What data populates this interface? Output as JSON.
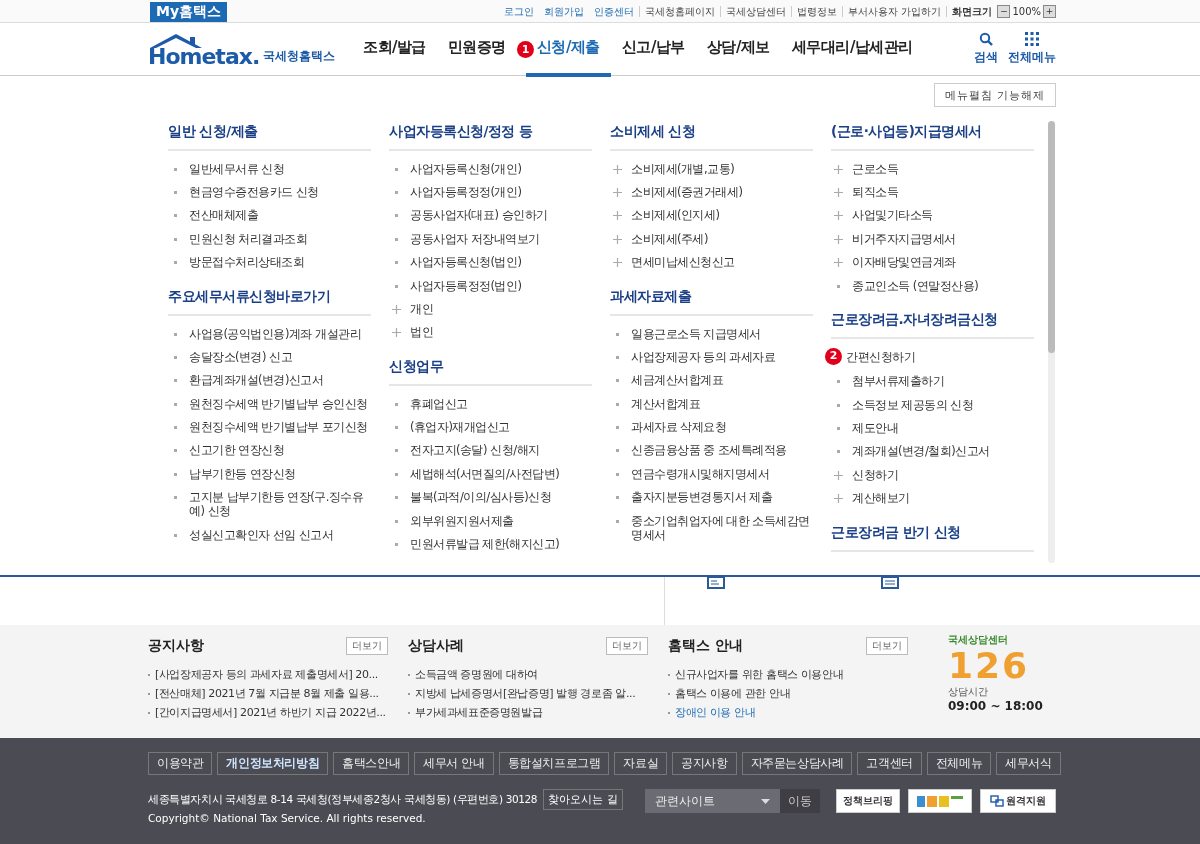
{
  "topbar": {
    "brand": "My홈택스",
    "links": [
      {
        "label": "로그인",
        "kind": "primary"
      },
      {
        "label": "회원가입",
        "kind": "primary"
      },
      {
        "label": "인증센터",
        "kind": "primary"
      },
      {
        "label": "국세청홈페이지",
        "kind": "plain"
      },
      {
        "label": "국세상담센터",
        "kind": "plain"
      },
      {
        "label": "법령정보",
        "kind": "plain"
      },
      {
        "label": "부서사용자 가입하기",
        "kind": "plain"
      }
    ],
    "zoom_label": "화면크기",
    "zoom_value": "100%",
    "zoom_out": "−",
    "zoom_in": "+"
  },
  "header": {
    "logo_word": "Hometax.",
    "logo_name": "국세청홈택스",
    "nav": [
      {
        "label": "조회/발급",
        "selected": false
      },
      {
        "label": "민원증명",
        "selected": false
      },
      {
        "label": "신청/제출",
        "selected": true,
        "badge": "1"
      },
      {
        "label": "신고/납부",
        "selected": false
      },
      {
        "label": "상담/제보",
        "selected": false
      },
      {
        "label": "세무대리/납세관리",
        "selected": false
      }
    ],
    "search": "검색",
    "all_menu": "전체메뉴"
  },
  "menu": {
    "toggle_button": "메뉴펼침 기능해제",
    "columns": [
      {
        "sections": [
          {
            "title": "일반 신청/제출",
            "items": [
              {
                "label": "일반세무서류 신청",
                "kind": "bullet"
              },
              {
                "label": "현금영수증전용카드 신청",
                "kind": "bullet"
              },
              {
                "label": "전산매체제출",
                "kind": "bullet"
              },
              {
                "label": "민원신청 처리결과조회",
                "kind": "bullet"
              },
              {
                "label": "방문접수처리상태조회",
                "kind": "bullet"
              }
            ]
          },
          {
            "title": "주요세무서류신청바로가기",
            "items": [
              {
                "label": "사업용(공익법인용)계좌 개설관리",
                "kind": "bullet"
              },
              {
                "label": "송달장소(변경) 신고",
                "kind": "bullet"
              },
              {
                "label": "환급계좌개설(변경)신고서",
                "kind": "bullet"
              },
              {
                "label": "원천징수세액 반기별납부 승인신청",
                "kind": "bullet"
              },
              {
                "label": "원천징수세액 반기별납부 포기신청",
                "kind": "bullet"
              },
              {
                "label": "신고기한 연장신청",
                "kind": "bullet"
              },
              {
                "label": "납부기한등 연장신청",
                "kind": "bullet"
              },
              {
                "label": "고지분 납부기한등 연장(구.징수유예) 신청",
                "kind": "bullet"
              },
              {
                "label": "성실신고확인자 선임 신고서",
                "kind": "bullet"
              }
            ]
          }
        ]
      },
      {
        "sections": [
          {
            "title": "사업자등록신청/정정 등",
            "items": [
              {
                "label": "사업자등록신청(개인)",
                "kind": "bullet"
              },
              {
                "label": "사업자등록정정(개인)",
                "kind": "bullet"
              },
              {
                "label": "공동사업자(대표) 승인하기",
                "kind": "bullet"
              },
              {
                "label": "공동사업자 저장내역보기",
                "kind": "bullet"
              },
              {
                "label": "사업자등록신청(법인)",
                "kind": "bullet"
              },
              {
                "label": "사업자등록정정(법인)",
                "kind": "bullet"
              },
              {
                "label": "개인",
                "kind": "plus"
              },
              {
                "label": "법인",
                "kind": "plus"
              }
            ]
          },
          {
            "title": "신청업무",
            "items": [
              {
                "label": "휴폐업신고",
                "kind": "bullet"
              },
              {
                "label": "(휴업자)재개업신고",
                "kind": "bullet"
              },
              {
                "label": "전자고지(송달) 신청/해지",
                "kind": "bullet"
              },
              {
                "label": "세법해석(서면질의/사전답변)",
                "kind": "bullet"
              },
              {
                "label": "불복(과적/이의/심사등)신청",
                "kind": "bullet"
              },
              {
                "label": "외부위원지원서제출",
                "kind": "bullet"
              },
              {
                "label": "민원서류발급 제한(해지신고)",
                "kind": "bullet"
              }
            ]
          }
        ]
      },
      {
        "sections": [
          {
            "title": "소비제세 신청",
            "items": [
              {
                "label": "소비제세(개별,교통)",
                "kind": "plus"
              },
              {
                "label": "소비제세(증권거래세)",
                "kind": "plus"
              },
              {
                "label": "소비제세(인지세)",
                "kind": "plus"
              },
              {
                "label": "소비제세(주세)",
                "kind": "plus"
              },
              {
                "label": "면세미납세신청신고",
                "kind": "plus"
              }
            ]
          },
          {
            "title": "과세자료제출",
            "items": [
              {
                "label": "일용근로소득 지급명세서",
                "kind": "bullet"
              },
              {
                "label": "사업장제공자 등의 과세자료",
                "kind": "bullet"
              },
              {
                "label": "세금계산서합계표",
                "kind": "bullet"
              },
              {
                "label": "계산서합계표",
                "kind": "bullet"
              },
              {
                "label": "과세자료 삭제요청",
                "kind": "bullet"
              },
              {
                "label": "신종금융상품 중 조세특례적용",
                "kind": "bullet"
              },
              {
                "label": "연금수령개시및해지명세서",
                "kind": "bullet"
              },
              {
                "label": "출자지분등변경통지서 제출",
                "kind": "bullet"
              },
              {
                "label": "중소기업취업자에 대한 소득세감면명세서",
                "kind": "bullet"
              }
            ]
          }
        ]
      },
      {
        "sections": [
          {
            "title": "(근로·사업등)지급명세서",
            "items": [
              {
                "label": "근로소득",
                "kind": "plus"
              },
              {
                "label": "퇴직소득",
                "kind": "plus"
              },
              {
                "label": "사업및기타소득",
                "kind": "plus"
              },
              {
                "label": "비거주자지급명세서",
                "kind": "plus"
              },
              {
                "label": "이자배당및연금계좌",
                "kind": "plus"
              },
              {
                "label": "종교인소득 (연말정산용)",
                "kind": "bullet"
              }
            ]
          },
          {
            "title": "근로장려금.자녀장려금신청",
            "items": [
              {
                "label": "간편신청하기",
                "kind": "badge",
                "badge": "2"
              },
              {
                "label": "첨부서류제출하기",
                "kind": "bullet"
              },
              {
                "label": "소득정보 제공동의 신청",
                "kind": "bullet"
              },
              {
                "label": "제도안내",
                "kind": "bullet"
              },
              {
                "label": "계좌개설(변경/철회)신고서",
                "kind": "bullet"
              },
              {
                "label": "신청하기",
                "kind": "plus"
              },
              {
                "label": "계산해보기",
                "kind": "plus"
              }
            ]
          },
          {
            "title": "근로장려금 반기 신청"
          }
        ]
      }
    ]
  },
  "news": [
    {
      "title": "공지사항",
      "more": "더보기",
      "items": [
        {
          "label": "[사업장제공자 등의 과세자료 제출명세서] 20...",
          "kind": "normal"
        },
        {
          "label": "[전산매체] 2021년 7월 지급분 8월 제출 일용...",
          "kind": "normal"
        },
        {
          "label": "[간이지급명세서] 2021년 하반기 지급 2022년...",
          "kind": "normal"
        }
      ]
    },
    {
      "title": "상담사례",
      "more": "더보기",
      "items": [
        {
          "label": "소득금액 증명원에 대하여",
          "kind": "normal"
        },
        {
          "label": "지방세 납세증명서[완납증명] 발행 경로좀 알...",
          "kind": "normal"
        },
        {
          "label": "부가세과세표준증명원발급",
          "kind": "normal"
        }
      ]
    },
    {
      "title": "홈택스 안내",
      "more": "더보기",
      "items": [
        {
          "label": "신규사업자를 위한 홈택스 이용안내",
          "kind": "normal"
        },
        {
          "label": "홈택스 이용에 관한 안내",
          "kind": "normal"
        },
        {
          "label": "장애인 이용 안내",
          "kind": "link"
        }
      ]
    }
  ],
  "center": {
    "name": "국세상담센터",
    "number": "126",
    "hours_label": "상담시간",
    "hours": "09:00 ~ 18:00"
  },
  "footer": {
    "links": [
      {
        "label": "이용약관",
        "highlighted": false
      },
      {
        "label": "개인정보처리방침",
        "highlighted": true
      },
      {
        "label": "홈택스안내",
        "highlighted": false
      },
      {
        "label": "세무서 안내",
        "highlighted": false
      },
      {
        "label": "통합설치프로그램",
        "highlighted": false
      },
      {
        "label": "자료실",
        "highlighted": false
      },
      {
        "label": "공지사항",
        "highlighted": false
      },
      {
        "label": "자주묻는상담사례",
        "highlighted": false
      },
      {
        "label": "고객센터",
        "highlighted": false
      },
      {
        "label": "전체메뉴",
        "highlighted": false
      },
      {
        "label": "세무서식",
        "highlighted": false
      }
    ],
    "address": "세종특별자치시 국세청로 8-14 국세청(정부세종2청사 국세청동) (우편번호) 30128",
    "directions": "찾아오시는 길",
    "copyright": "Copyright© National Tax Service. All rights reserved.",
    "site_select": "관련사이트",
    "go": "이동",
    "briefing": "정책브리핑",
    "remote": "원격지원"
  }
}
